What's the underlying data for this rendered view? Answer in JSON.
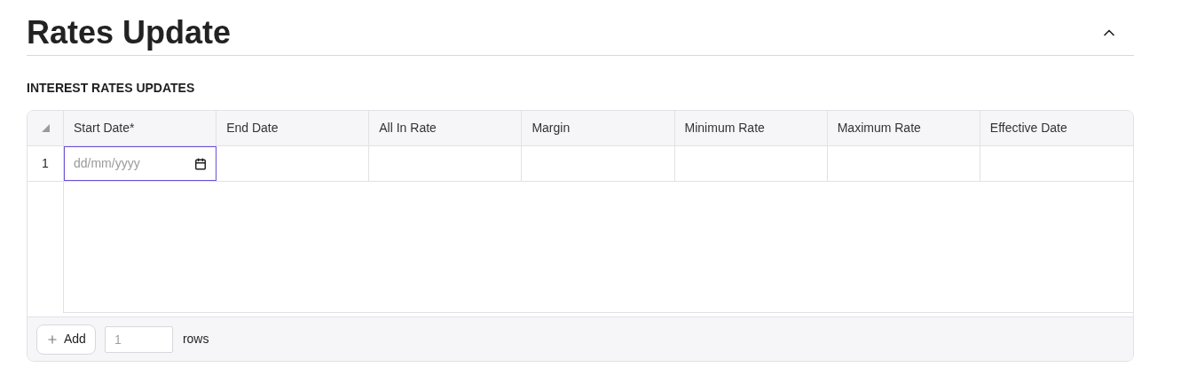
{
  "section": {
    "title": "Rates Update",
    "expanded": true
  },
  "table": {
    "title": "INTEREST RATES UPDATES",
    "columns": [
      "Start Date*",
      "End Date",
      "All In Rate",
      "Margin",
      "Minimum Rate",
      "Maximum Rate",
      "Effective Date"
    ],
    "rows": [
      {
        "number": "1",
        "start_date": {
          "placeholder": "dd/mm/yyyy",
          "focused": true
        }
      }
    ]
  },
  "footer": {
    "add_button": "Add",
    "count_field": {
      "placeholder": "1"
    },
    "unit": "rows"
  }
}
